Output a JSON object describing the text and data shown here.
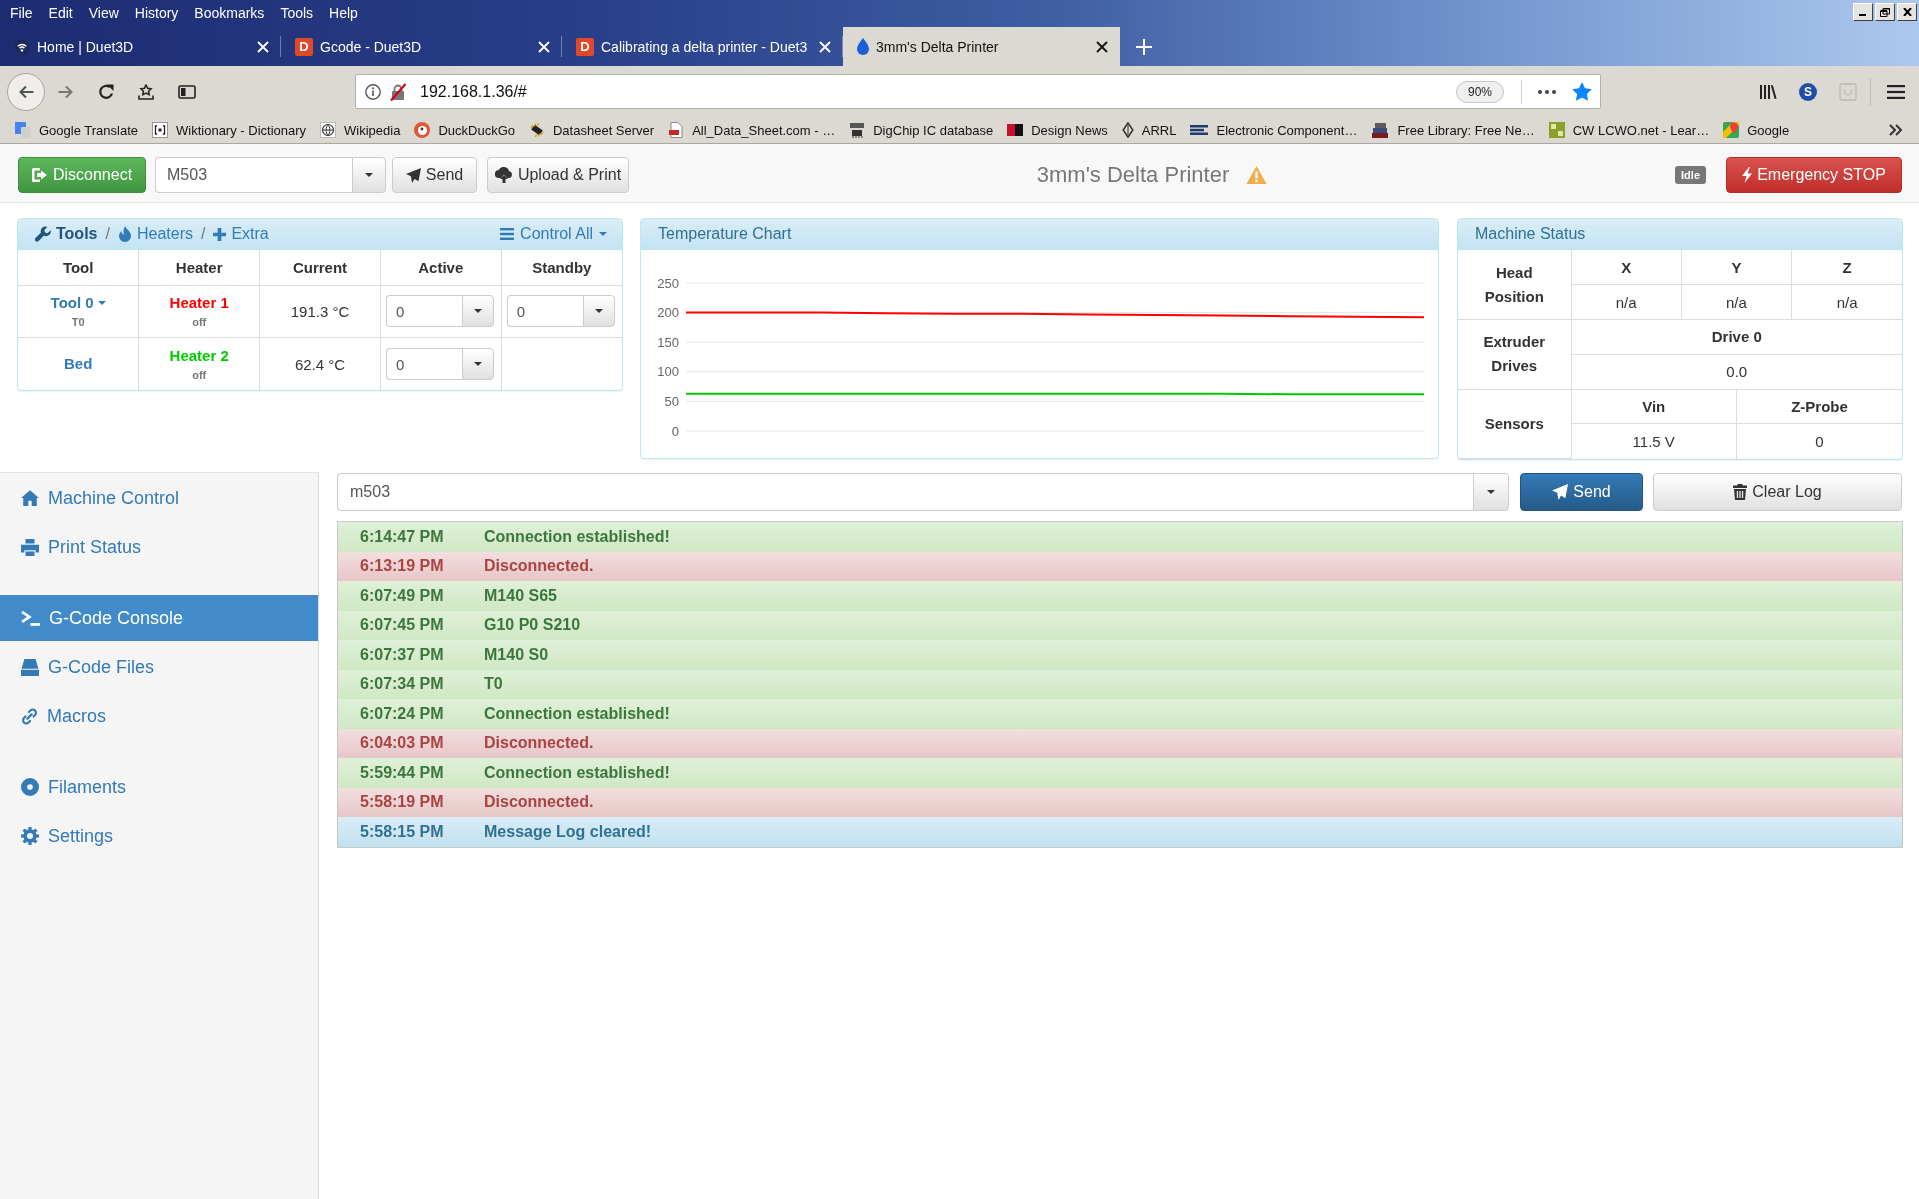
{
  "browser": {
    "menu": [
      "File",
      "Edit",
      "View",
      "History",
      "Bookmarks",
      "Tools",
      "Help"
    ],
    "tabs": [
      {
        "title": "Home | Duet3D",
        "selected": false
      },
      {
        "title": "Gcode - Duet3D",
        "badge": "D",
        "selected": false
      },
      {
        "title": "Calibrating a delta printer - Duet3",
        "badge": "D",
        "selected": false
      },
      {
        "title": "3mm's Delta Printer",
        "selected": true
      }
    ],
    "address": {
      "url": "192.168.1.36/#",
      "zoom": "90%",
      "bookmarked": true
    },
    "extension_label": "S",
    "bookmarks": [
      "Google Translate",
      "Wiktionary - Dictionary",
      "Wikipedia",
      "DuckDuckGo",
      "Datasheet Server",
      "All_Data_Sheet.com - …",
      "DigChip IC database",
      "Design News",
      "ARRL",
      "Electronic Component…",
      "Free Library: Free Ne…",
      "CW LCWO.net - Lear…",
      "Google"
    ]
  },
  "toolbar": {
    "disconnect": "Disconnect",
    "gcode": "M503",
    "send": "Send",
    "upload": "Upload & Print",
    "title": "3mm's Delta Printer",
    "warning": true,
    "status": "Idle",
    "emergency_stop": "Emergency STOP"
  },
  "tools": {
    "tabs": [
      {
        "label": "Tools",
        "selected": true
      },
      {
        "label": "Heaters",
        "selected": false
      },
      {
        "label": "Extra",
        "selected": false
      }
    ],
    "separators": [
      "/",
      "/"
    ],
    "control_all": "Control All",
    "columns": [
      "Tool",
      "Heater",
      "Current",
      "Active",
      "Standby"
    ],
    "rows": [
      {
        "tool": "Tool 0",
        "dropdown": true,
        "tool_code": "T0",
        "heater": "Heater 1",
        "color": "#ff0000",
        "heater_state": "off",
        "current": "191.3 °C",
        "active": "0",
        "standby": "0"
      },
      {
        "tool": "Bed",
        "dropdown": false,
        "heater": "Heater 2",
        "color": "#00cc00",
        "heater_state": "off",
        "current": "62.4 °C",
        "active": "0"
      }
    ]
  },
  "temperature_chart": {
    "title": "Temperature Chart",
    "chart_data": {
      "type": "line",
      "ylim": [
        0,
        250
      ],
      "yticks": [
        0,
        50,
        100,
        150,
        200,
        250
      ],
      "grid": true,
      "series": [
        {
          "color": "#ff0000",
          "values": [
            200,
            200,
            200,
            199,
            198,
            198,
            197,
            196,
            195,
            194,
            193,
            192
          ]
        },
        {
          "color": "#00cc00",
          "values": [
            63,
            63,
            63,
            63,
            63,
            63,
            63,
            63,
            63,
            62,
            62,
            62
          ]
        }
      ]
    }
  },
  "machine_status": {
    "title": "Machine Status",
    "head_position": {
      "label": "Head Position",
      "axes": [
        {
          "name": "X",
          "value": "n/a"
        },
        {
          "name": "Y",
          "value": "n/a"
        },
        {
          "name": "Z",
          "value": "n/a"
        }
      ]
    },
    "extruder_drives": {
      "label": "Extruder Drives",
      "drives": [
        {
          "name": "Drive 0",
          "value": "0.0"
        }
      ]
    },
    "sensors": {
      "label": "Sensors",
      "items": [
        {
          "name": "Vin",
          "value": "11.5 V"
        },
        {
          "name": "Z-Probe",
          "value": "0"
        }
      ]
    }
  },
  "sidebar": {
    "groups": [
      {
        "items": [
          {
            "label": "Machine Control",
            "selected": false
          },
          {
            "label": "Print Status",
            "selected": false
          }
        ]
      },
      {
        "items": [
          {
            "label": "G-Code Console",
            "selected": true
          },
          {
            "label": "G-Code Files",
            "selected": false
          },
          {
            "label": "Macros",
            "selected": false
          }
        ]
      },
      {
        "items": [
          {
            "label": "Filaments",
            "selected": false
          },
          {
            "label": "Settings",
            "selected": false
          }
        ]
      }
    ]
  },
  "console": {
    "input": "m503",
    "send": "Send",
    "clear": "Clear Log",
    "log": [
      {
        "time": "6:14:47 PM",
        "message": "Connection established!",
        "kind": "success"
      },
      {
        "time": "6:13:19 PM",
        "message": "Disconnected.",
        "kind": "error"
      },
      {
        "time": "6:07:49 PM",
        "message": "M140 S65",
        "kind": "success"
      },
      {
        "time": "6:07:45 PM",
        "message": "G10 P0 S210",
        "kind": "success"
      },
      {
        "time": "6:07:37 PM",
        "message": "M140 S0",
        "kind": "success"
      },
      {
        "time": "6:07:34 PM",
        "message": "T0",
        "kind": "success"
      },
      {
        "time": "6:07:24 PM",
        "message": "Connection established!",
        "kind": "success"
      },
      {
        "time": "6:04:03 PM",
        "message": "Disconnected.",
        "kind": "error"
      },
      {
        "time": "5:59:44 PM",
        "message": "Connection established!",
        "kind": "success"
      },
      {
        "time": "5:58:19 PM",
        "message": "Disconnected.",
        "kind": "error"
      },
      {
        "time": "5:58:15 PM",
        "message": "Message Log cleared!",
        "kind": "info"
      }
    ]
  }
}
